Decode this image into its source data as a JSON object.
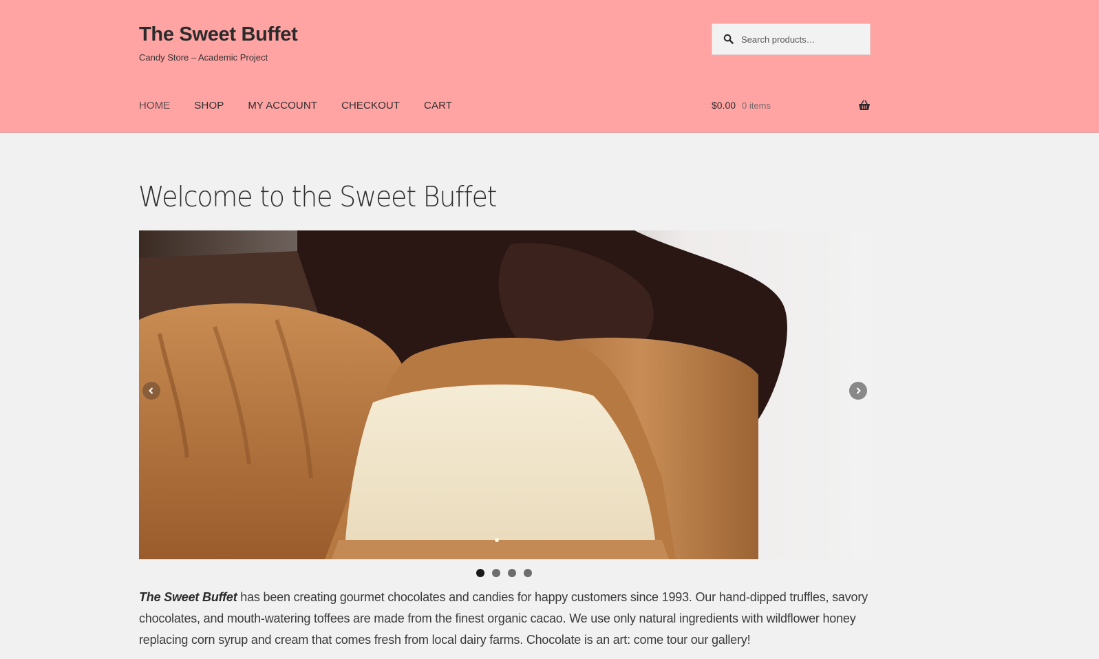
{
  "site": {
    "title": "The Sweet Buffet",
    "tagline": "Candy Store – Academic Project"
  },
  "search": {
    "placeholder": "Search products…",
    "icon": "search-icon"
  },
  "nav": {
    "items": [
      {
        "label": "HOME",
        "active": true
      },
      {
        "label": "SHOP",
        "active": false
      },
      {
        "label": "MY ACCOUNT",
        "active": false
      },
      {
        "label": "CHECKOUT",
        "active": false
      },
      {
        "label": "CART",
        "active": false
      }
    ]
  },
  "cart": {
    "amount": "$0.00",
    "count": "0 items",
    "icon": "basket-icon"
  },
  "page": {
    "title": "Welcome to the Sweet Buffet"
  },
  "slider": {
    "image": "chocolate-truffles-photo",
    "prev_icon": "chevron-left-icon",
    "next_icon": "chevron-right-icon",
    "slide_count": 4,
    "active_slide": 1
  },
  "intro": {
    "brand": "The Sweet Buffet",
    "text": " has been creating gourmet chocolates and candies for happy customers since 1993. Our hand-dipped truffles, savory chocolates, and mouth-watering toffees are made from the finest organic cacao. We use only natural ingredients with wildflower honey replacing corn syrup and cream that comes fresh from local dairy farms. Chocolate is an art: come tour our gallery!"
  },
  "colors": {
    "header_bg": "#ffa3a3",
    "page_bg": "#f1f1f1",
    "text": "#3a3a3a"
  }
}
